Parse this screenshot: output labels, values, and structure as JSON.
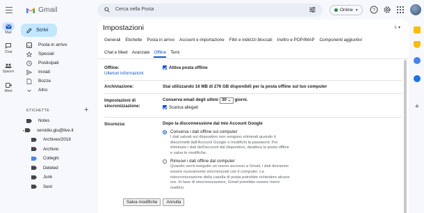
{
  "app": {
    "name": "Gmail"
  },
  "search": {
    "placeholder": "Cerca nella Posta"
  },
  "status": {
    "label": "Online"
  },
  "rail": [
    {
      "label": "Mail",
      "icon": "mail-icon"
    },
    {
      "label": "Chat",
      "icon": "chat-icon"
    },
    {
      "label": "Spaces",
      "icon": "spaces-icon"
    },
    {
      "label": "Meet",
      "icon": "meet-icon"
    }
  ],
  "compose": {
    "label": "Scrivi"
  },
  "nav": [
    {
      "label": "Posta in arrivo",
      "icon": "inbox-icon"
    },
    {
      "label": "Speciali",
      "icon": "star-icon"
    },
    {
      "label": "Posticipati",
      "icon": "clock-icon"
    },
    {
      "label": "Inviati",
      "icon": "send-icon"
    },
    {
      "label": "Bozze",
      "icon": "draft-icon"
    },
    {
      "label": "Altro",
      "icon": "chevron-down-icon"
    }
  ],
  "labels": {
    "heading": "ETICHETTE",
    "items": [
      {
        "label": "Notes",
        "indent": 0,
        "color": "#444746",
        "expander": false
      },
      {
        "label": "servidio.giu@live.it",
        "indent": 0,
        "color": "#444746",
        "expander": true
      },
      {
        "label": "Archives/2018",
        "indent": 1,
        "color": "#444746"
      },
      {
        "label": "Archivio",
        "indent": 1,
        "color": "#444746"
      },
      {
        "label": "Colleghi",
        "indent": 1,
        "color": "#4285f4"
      },
      {
        "label": "Deleted",
        "indent": 1,
        "color": "#444746"
      },
      {
        "label": "Junk",
        "indent": 1,
        "color": "#444746"
      },
      {
        "label": "Sent",
        "indent": 1,
        "color": "#444746"
      }
    ]
  },
  "settings": {
    "title": "Impostazioni",
    "lang": "Iₜ ▾",
    "tabs_row1": [
      "Generali",
      "Etichette",
      "Posta in arrivo",
      "Account e importazione",
      "Filtri e indirizzi bloccati",
      "Inoltro e POP/IMAP",
      "Componenti aggiuntivi"
    ],
    "tabs_row2": [
      "Chat e Meet",
      "Avanzate",
      "Offline",
      "Temi"
    ],
    "active_tab": "Offline",
    "offline": {
      "label": "Offline:",
      "link": "Ulteriori informazioni",
      "checkbox": "Attiva posta offline"
    },
    "storage": {
      "label": "Archiviazione:",
      "text": "Stai utilizzando 16 MB di 276 GB disponibili per la posta offline sul tuo computer"
    },
    "sync": {
      "label": "Impostazioni di sincronizzazione:",
      "prefix": "Conserva email degli ultimi",
      "days": "30",
      "suffix": "giorni.",
      "attachments": "Scarica allegati"
    },
    "security": {
      "label": "Sicurezza:",
      "heading": "Dopo la disconnessione dal mio Account Google",
      "option1_title": "Conserva i dati offline sul computer",
      "option1_desc": "I dati salvati sul dispositivo non vengono eliminati quando ti disconnetti dall'Account Google o modifichi la password. Per eliminare i dati dell'account dal dispositivo, disattiva la posta offline e salva le modifiche.",
      "option2_title": "Rimuovi i dati offline dal computer",
      "option2_desc": "Quando verrà eseguito un nuovo accesso a Gmail, i dati dovranno essere nuovamente sincronizzati con il computer. La risincronizzazione della casella di posta potrebbe richiedere alcune ore. In fase di sincronizzazione, Gmail potrebbe essere meno reattivo."
    },
    "buttons": {
      "save": "Salva modifiche",
      "cancel": "Annulla"
    }
  },
  "colors": {
    "accent": "#0b57d0",
    "compose_bg": "#c2e7ff",
    "rail_active": "#d3e3fd"
  }
}
